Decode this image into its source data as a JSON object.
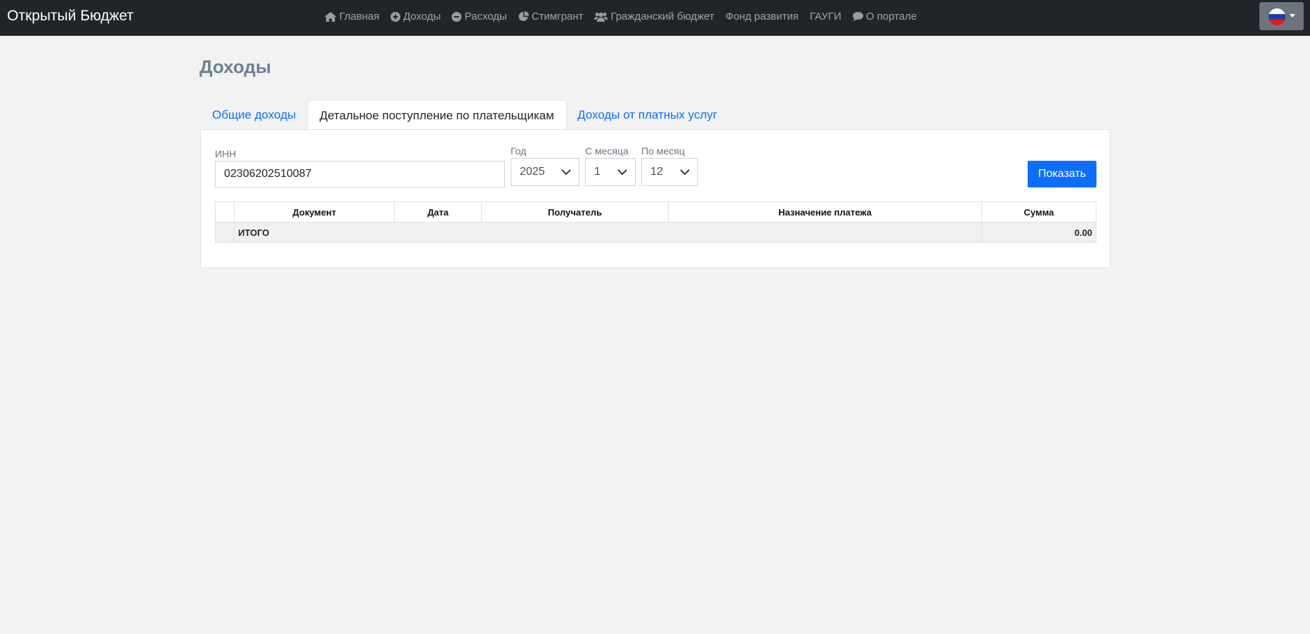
{
  "navbar": {
    "brand": "Открытый Бюджет",
    "items": [
      {
        "label": "Главная",
        "icon": "home-icon"
      },
      {
        "label": "Доходы",
        "icon": "plus-circle-icon"
      },
      {
        "label": "Расходы",
        "icon": "minus-circle-icon"
      },
      {
        "label": "Стимгрант",
        "icon": "pie-chart-icon"
      },
      {
        "label": "Гражданский бюджет",
        "icon": "users-icon"
      },
      {
        "label": "Фонд развития",
        "icon": ""
      },
      {
        "label": "ГАУГИ",
        "icon": ""
      },
      {
        "label": "О портале",
        "icon": "comment-icon"
      }
    ],
    "language_flag": "russia-flag-icon"
  },
  "page": {
    "title": "Доходы"
  },
  "tabs": [
    {
      "label": "Общие доходы",
      "active": false
    },
    {
      "label": "Детальное поступление по плательщикам",
      "active": true
    },
    {
      "label": "Доходы от платных услуг",
      "active": false
    }
  ],
  "filters": {
    "inn_label": "ИНН",
    "inn_value": "02306202510087",
    "year_label": "Год",
    "year_value": "2025",
    "from_month_label": "С месяца",
    "from_month_value": "1",
    "to_month_label": "По месяц",
    "to_month_value": "12",
    "show_button": "Показать"
  },
  "table": {
    "columns": [
      "",
      "Документ",
      "Дата",
      "Получатель",
      "Назначение платежа",
      "Сумма"
    ],
    "total_label": "ИТОГО",
    "total_sum": "0.00"
  },
  "colors": {
    "navbar": "#212529",
    "accent": "#0d6efd",
    "title": "#6e7f96"
  }
}
